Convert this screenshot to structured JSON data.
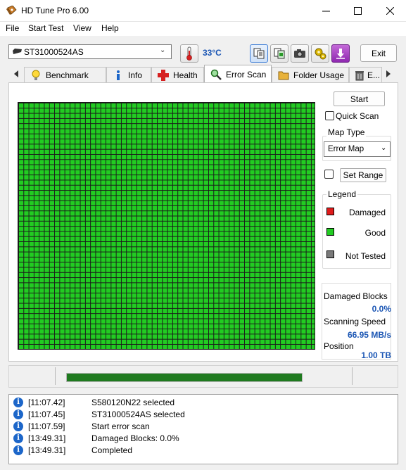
{
  "window": {
    "title": "HD Tune Pro 6.00",
    "minimize_icon": "minimize-icon",
    "maximize_icon": "maximize-icon",
    "close_icon": "close-icon"
  },
  "menu": [
    "File",
    "Start Test",
    "View",
    "Help"
  ],
  "toolbar": {
    "drive": "ST31000524AS",
    "temperature": "33°C",
    "exit_label": "Exit",
    "icons": [
      "copy-text-icon",
      "copy-screenshot-icon",
      "camera-icon",
      "options-icon",
      "save-icon"
    ]
  },
  "tabs": [
    {
      "label": "Benchmark",
      "icon": "lightbulb-icon"
    },
    {
      "label": "Info",
      "icon": "info-icon"
    },
    {
      "label": "Health",
      "icon": "health-cross-icon"
    },
    {
      "label": "Error Scan",
      "icon": "magnifier-icon",
      "active": true
    },
    {
      "label": "Folder Usage",
      "icon": "folder-icon"
    },
    {
      "label": "E...",
      "icon": "trash-icon"
    }
  ],
  "error_scan": {
    "start_label": "Start",
    "quick_scan_label": "Quick Scan",
    "quick_scan_checked": false,
    "map_type_title": "Map Type",
    "map_type_value": "Error Map",
    "set_range_label": "Set Range",
    "set_range_checked": false,
    "legend_title": "Legend",
    "legend": [
      {
        "label": "Damaged",
        "color": "#e01b1b"
      },
      {
        "label": "Good",
        "color": "#22cc22"
      },
      {
        "label": "Not Tested",
        "color": "#7a7a7a"
      }
    ],
    "stats": {
      "damaged_blocks_label": "Damaged Blocks",
      "damaged_blocks_value": "0.0%",
      "scanning_speed_label": "Scanning Speed",
      "scanning_speed_value": "66.95 MB/s",
      "position_label": "Position",
      "position_value": "1.00 TB"
    },
    "block_map_state": "all good",
    "progress": 1.0
  },
  "log": [
    {
      "time": "[11:07.42]",
      "message": "S580120N22 selected"
    },
    {
      "time": "[11:07.45]",
      "message": "ST31000524AS selected"
    },
    {
      "time": "[11:07.59]",
      "message": "Start error scan"
    },
    {
      "time": "[13:49.31]",
      "message": "Damaged Blocks: 0.0%"
    },
    {
      "time": "[13:49.31]",
      "message": "Completed"
    }
  ],
  "colors": {
    "accent_blue": "#1b56b4",
    "good_green": "#22cc22",
    "progress_green": "#1f7a1f"
  }
}
